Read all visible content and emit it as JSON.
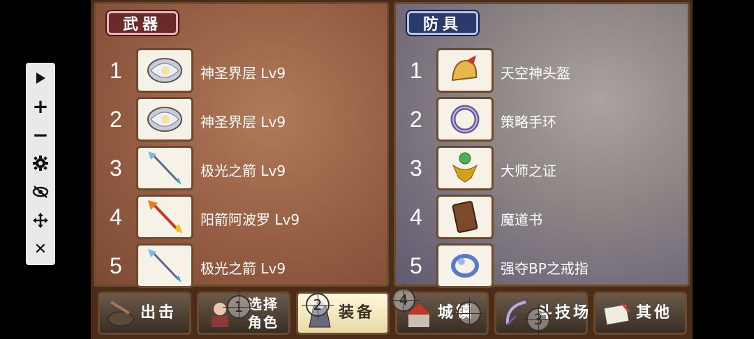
{
  "toolbar": {
    "icons": [
      "play-icon",
      "plus-icon",
      "minus-icon",
      "gear-icon",
      "eye-off-icon",
      "move-icon",
      "close-icon"
    ],
    "plus_glyph": "+",
    "minus_glyph": "−",
    "close_glyph": "✕"
  },
  "weapons": {
    "tab_label": "武器",
    "items": [
      {
        "num": "1",
        "name": "神圣界层 Lv9",
        "icon": "shell-icon"
      },
      {
        "num": "2",
        "name": "神圣界层 Lv9",
        "icon": "shell-icon"
      },
      {
        "num": "3",
        "name": "极光之箭 Lv9",
        "icon": "arrow-icon"
      },
      {
        "num": "4",
        "name": "阳箭阿波罗 Lv9",
        "icon": "fire-arrow-icon"
      },
      {
        "num": "5",
        "name": "极光之箭 Lv9",
        "icon": "arrow-icon"
      }
    ]
  },
  "armor": {
    "tab_label": "防具",
    "items": [
      {
        "num": "1",
        "name": "天空神头盔",
        "icon": "helmet-icon"
      },
      {
        "num": "2",
        "name": "策略手环",
        "icon": "bracelet-icon"
      },
      {
        "num": "3",
        "name": "大师之证",
        "icon": "badge-icon"
      },
      {
        "num": "4",
        "name": "魔道书",
        "icon": "book-icon"
      },
      {
        "num": "5",
        "name": "强夺BP之戒指",
        "icon": "ring-icon"
      }
    ]
  },
  "bottom_menu": {
    "sortie": "出击",
    "select_line1": "选择",
    "select_line2": "角色",
    "equip": "装备",
    "town": "城镇",
    "arena": "斗技场",
    "other": "其他"
  },
  "markers": [
    "1",
    "2",
    "4",
    "3"
  ]
}
